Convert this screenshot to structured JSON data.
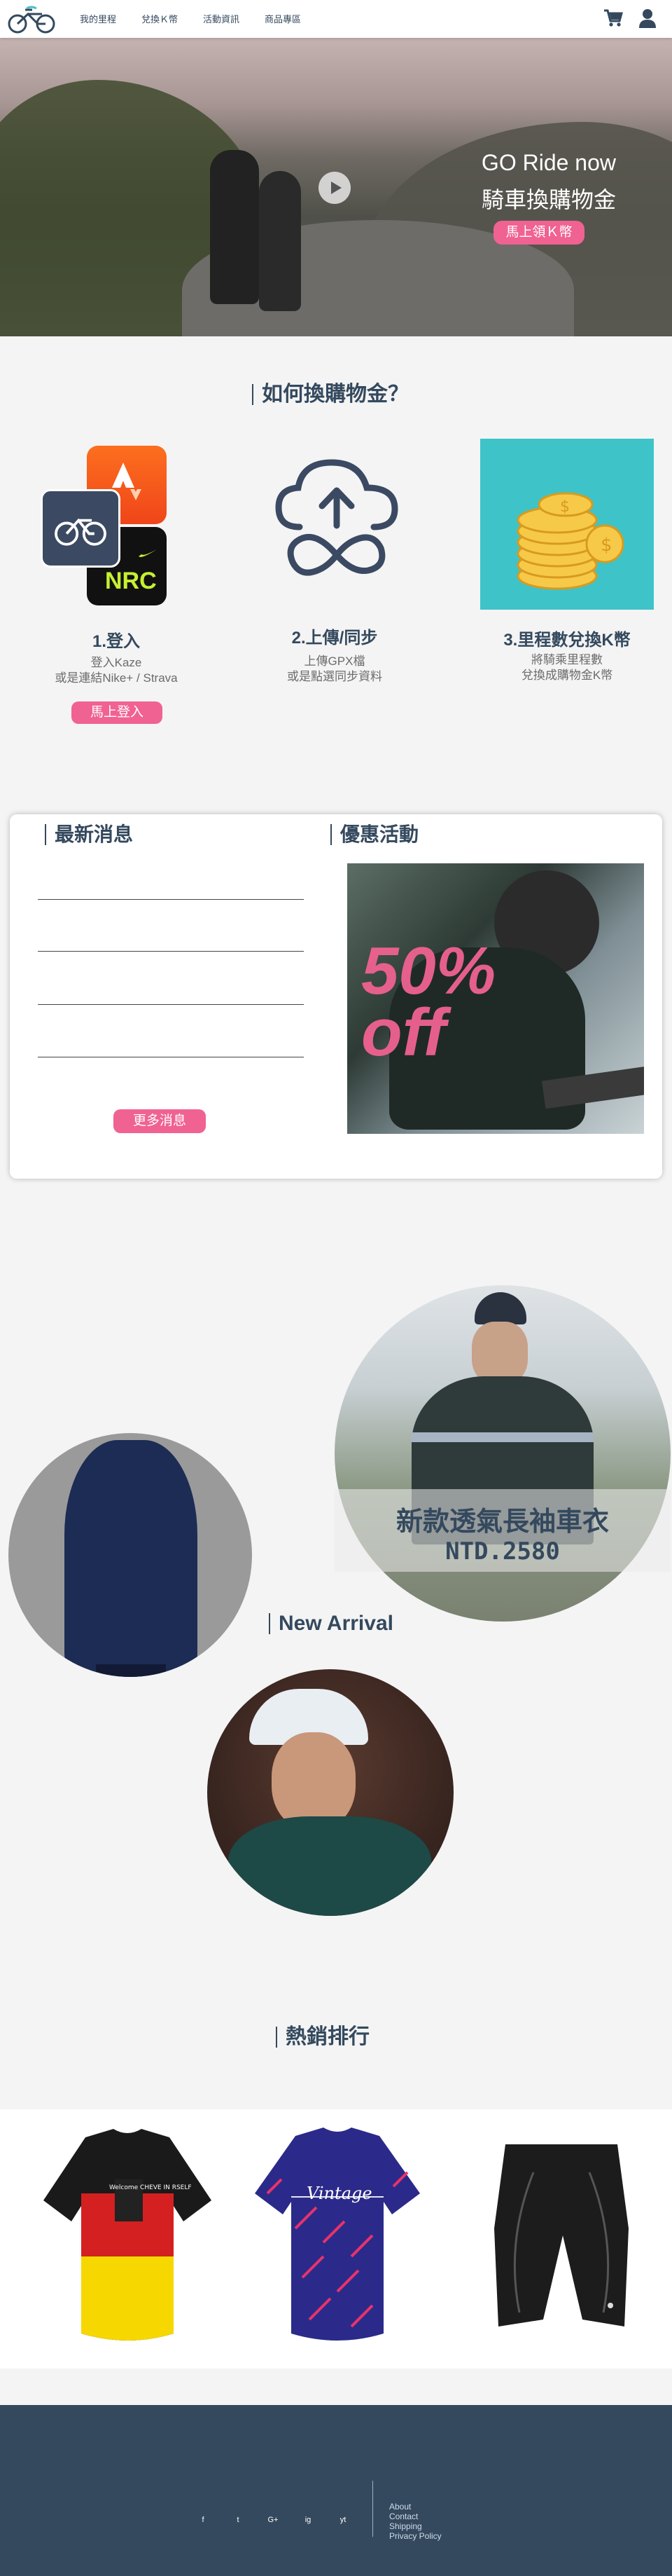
{
  "nav": {
    "links": [
      "我的里程",
      "兌換Ｋ幣",
      "活動資訊",
      "商品專區"
    ]
  },
  "hero": {
    "title": "GO Ride now",
    "subtitle": "騎車換購物金",
    "button": "馬上領Ｋ幣"
  },
  "how_to": {
    "heading": "如何換購物金？",
    "steps": [
      {
        "title": "1.登入",
        "desc1": "登入Kaze",
        "desc2": "或是連結Nike+ / Strava",
        "button": "馬上登入"
      },
      {
        "title": "2.上傳/同步",
        "desc1": "上傳GPX檔",
        "desc2": "或是點選同步資料"
      },
      {
        "title": "3.里程數兌換K幣",
        "desc1": "將騎乘里程數",
        "desc2": "兌換成購物金K幣"
      }
    ],
    "nrc_label": "NRC"
  },
  "news": {
    "heading": "最新消息",
    "more_button": "更多消息",
    "promo_heading": "優惠活動",
    "promo_text_1": "50%",
    "promo_text_2": "off"
  },
  "new_arrival": {
    "heading": "New Arrival",
    "product_name": "新款透氣長袖車衣",
    "product_price": "NTD.2580"
  },
  "best_sellers": {
    "heading": "熱銷排行",
    "jersey_1_text": "Welcome CHEVE IN RSELF",
    "jersey_2_text": "Vintage"
  },
  "footer": {
    "social": [
      "f",
      "t",
      "G+",
      "ig",
      "yt"
    ],
    "links": [
      "About",
      "Contact",
      "Shipping",
      "Privacy Policy"
    ]
  },
  "colors": {
    "primary": "#34495e",
    "accent": "#f06292",
    "background": "#f4f4f4"
  }
}
